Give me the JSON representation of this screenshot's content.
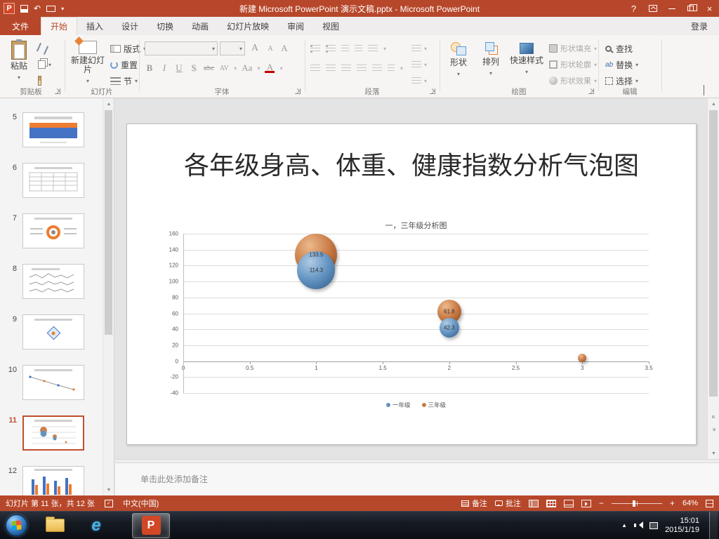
{
  "icons": {
    "caret": "▾",
    "close": "×",
    "help": "?",
    "undo": "↶",
    "up": "▲",
    "down": "▼",
    "double_left": "«",
    "check": "✓",
    "minus": "−",
    "plus": "+",
    "tray_hidden": "▲",
    "e_logo": "e"
  },
  "window": {
    "title": "新建 Microsoft PowerPoint 演示文稿.pptx - Microsoft PowerPoint",
    "signin": "登录"
  },
  "ribbon": {
    "tabs": [
      "文件",
      "开始",
      "插入",
      "设计",
      "切换",
      "动画",
      "幻灯片放映",
      "审阅",
      "视图"
    ],
    "group_labels": [
      "剪贴板",
      "幻灯片",
      "字体",
      "段落",
      "绘图",
      "编辑"
    ],
    "clipboard": {
      "paste": "粘贴"
    },
    "slides": {
      "new_slide": "新建幻灯片",
      "layout": "版式",
      "reset": "重置",
      "section": "节"
    },
    "font": {
      "bold": "B",
      "italic": "I",
      "underline": "U",
      "shadow": "S",
      "strike": "abc",
      "spacing": "AV",
      "case": "Aa",
      "color": "A",
      "grow": "A",
      "shrink": "A",
      "clear": "A"
    },
    "drawing": {
      "shapes": "形状",
      "arrange": "排列",
      "quick_styles": "快速样式",
      "fill": "形状填充",
      "outline": "形状轮廓",
      "effects": "形状效果"
    },
    "editing": {
      "find": "查找",
      "replace": "替换",
      "select": "选择"
    }
  },
  "sidebar": {
    "slides": [
      "5",
      "6",
      "7",
      "8",
      "9",
      "10",
      "11",
      "12"
    ],
    "selected": "11"
  },
  "slide": {
    "title": "各年级身高、体重、健康指数分析气泡图"
  },
  "chart_data": {
    "type": "bubble",
    "title": "一，三年级分析图",
    "x_axis": {
      "min": 0,
      "max": 3.5,
      "step": 0.5
    },
    "y_axis": {
      "min": -40,
      "max": 160,
      "step": 20
    },
    "grid": true,
    "legend_position": "bottom",
    "series": [
      {
        "name": "一年级",
        "color": "#6393C1",
        "color_light": "#AECBE4",
        "color_dark": "#2E5A87",
        "points": [
          {
            "x": 1,
            "y": 114.3,
            "r": 27,
            "label": "114.3"
          },
          {
            "x": 2,
            "y": 42.3,
            "r": 14,
            "label": "42.3"
          }
        ]
      },
      {
        "name": "三年级",
        "color": "#C97B45",
        "color_light": "#EDB98C",
        "color_dark": "#7E441B",
        "points": [
          {
            "x": 1,
            "y": 133.5,
            "r": 30,
            "label": "133.5"
          },
          {
            "x": 2,
            "y": 61.8,
            "r": 17,
            "label": "61.8"
          },
          {
            "x": 3,
            "y": 4,
            "r": 6,
            "label": ""
          }
        ]
      }
    ]
  },
  "notes": {
    "placeholder": "单击此处添加备注"
  },
  "status": {
    "slide_info": "幻灯片 第 11 张，共 12 张",
    "language": "中文(中国)",
    "notes_btn": "备注",
    "comments_btn": "批注",
    "zoom": "64%"
  },
  "taskbar": {
    "time": "15:01",
    "date": "2015/1/19"
  }
}
